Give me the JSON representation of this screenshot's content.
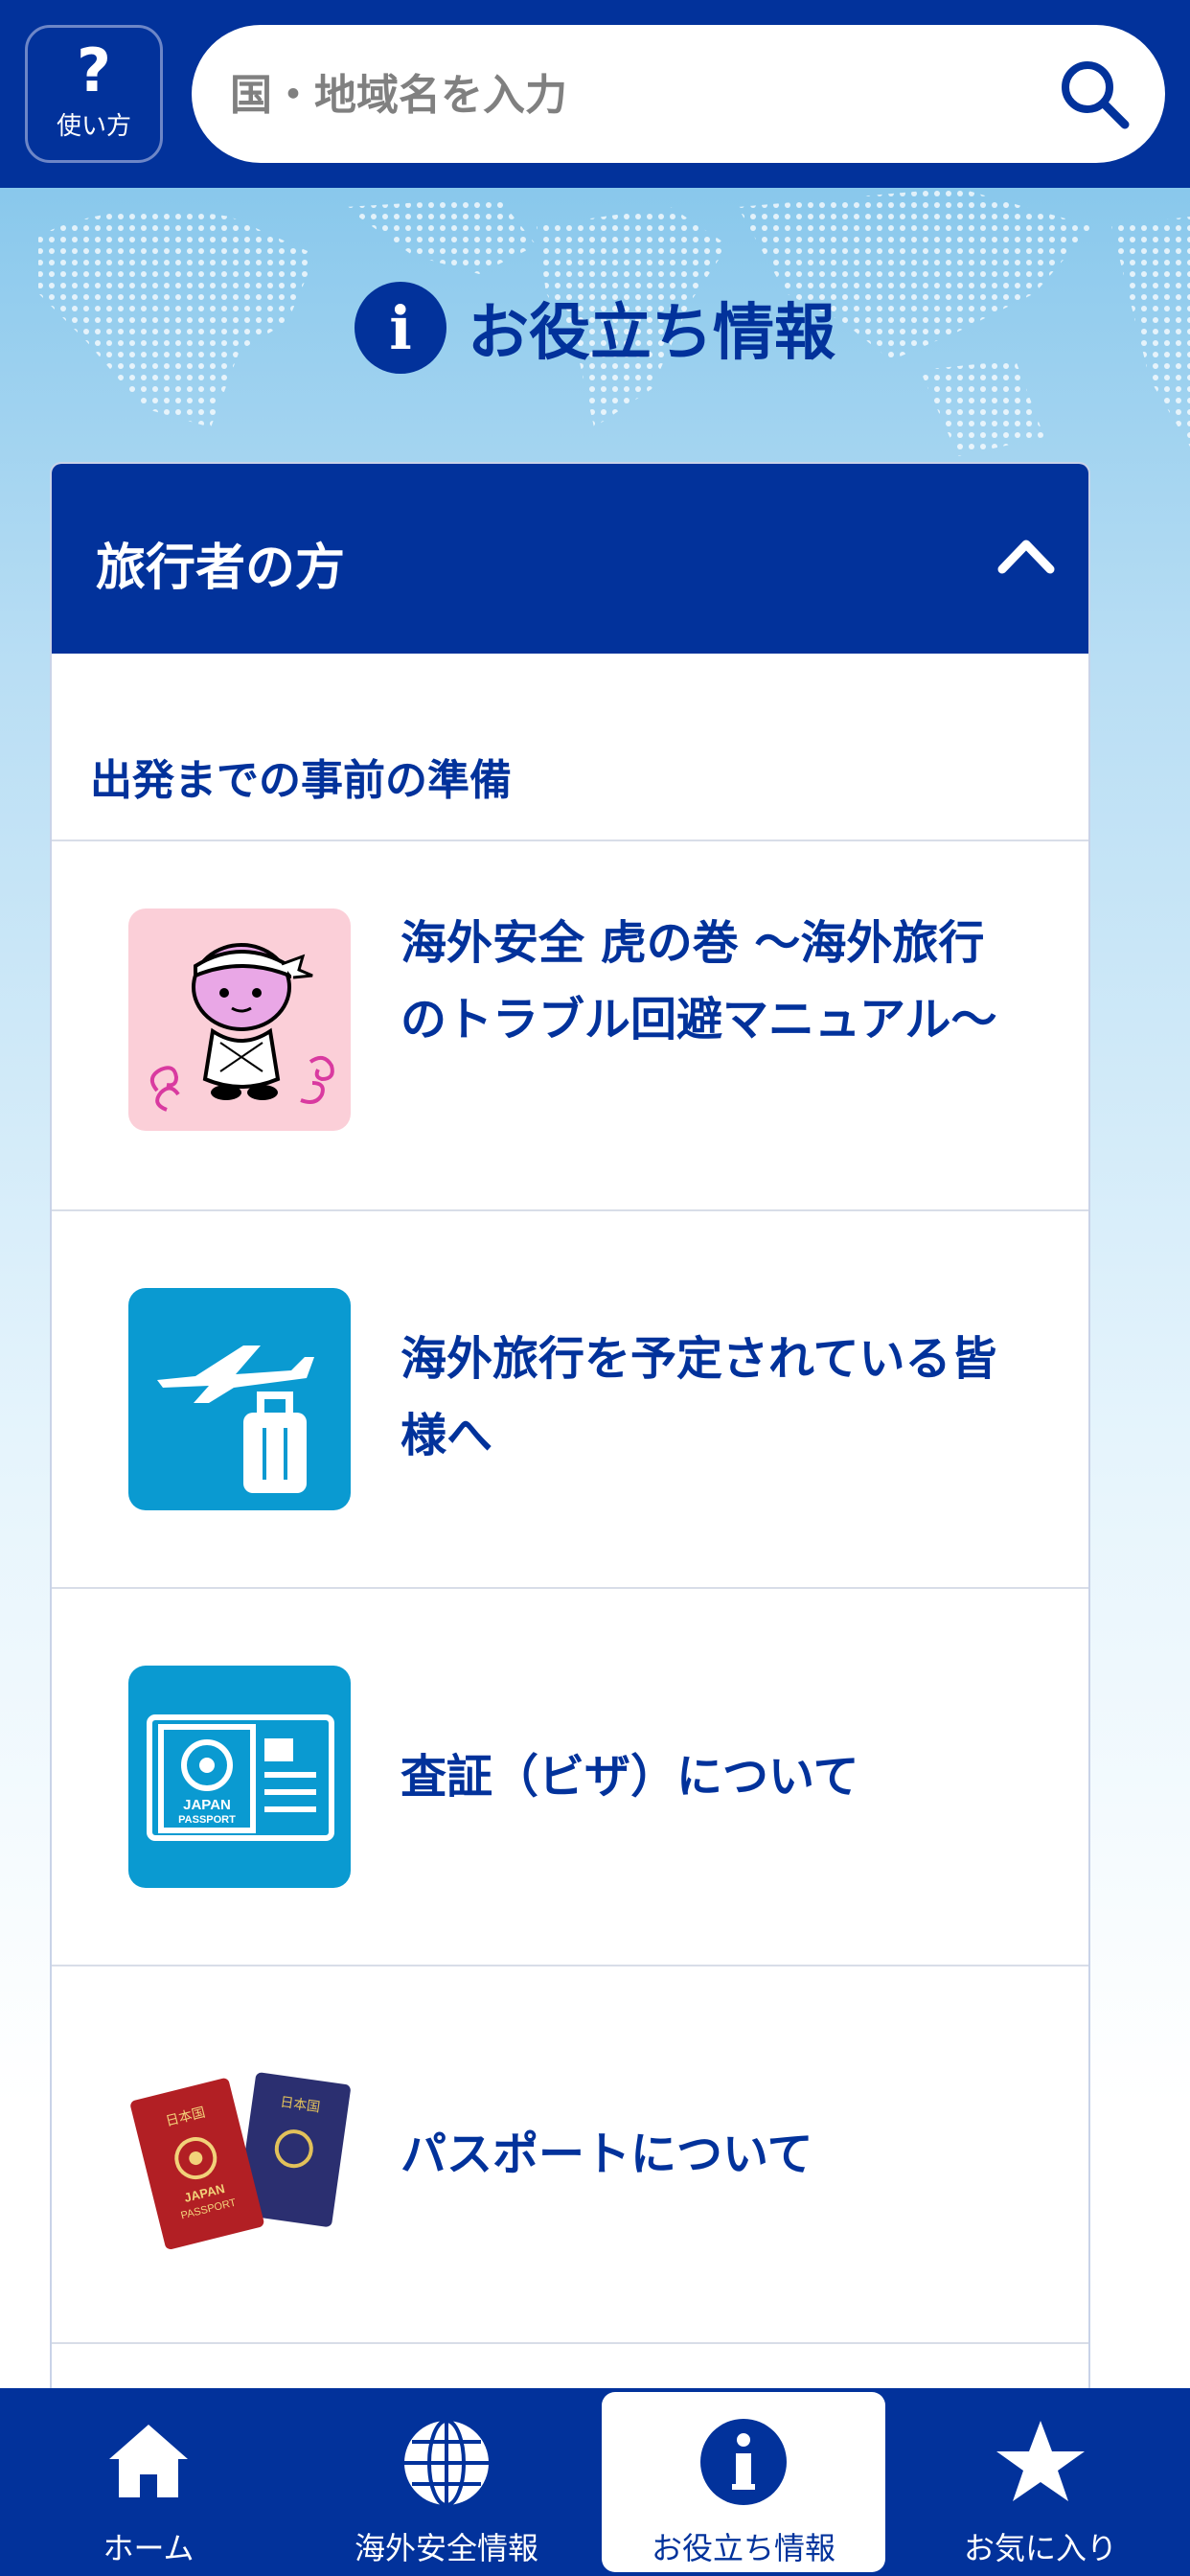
{
  "header": {
    "help_label": "使い方",
    "help_symbol": "?",
    "search_placeholder": "国・地域名を入力"
  },
  "page": {
    "title": "お役立ち情報",
    "info_symbol": "i"
  },
  "card": {
    "title": "旅行者の方",
    "section_title": "出発までの事前の準備",
    "items": [
      {
        "label": "海外安全 虎の巻 ～海外旅行のトラブル回避マニュアル～",
        "icon": "tiger-mascot-icon"
      },
      {
        "label": "海外旅行を予定されている皆様へ",
        "icon": "airplane-suitcase-icon"
      },
      {
        "label": "査証（ビザ）について",
        "icon": "passport-visa-icon"
      },
      {
        "label": "パスポートについて",
        "icon": "passports-icon"
      }
    ],
    "passport_texts": {
      "japan": "JAPAN",
      "passport": "PASSPORT",
      "nihonkoku": "日本国"
    }
  },
  "bottom_nav": {
    "items": [
      {
        "label": "ホーム",
        "icon": "home-icon"
      },
      {
        "label": "海外安全情報",
        "icon": "globe-icon"
      },
      {
        "label": "お役立ち情報",
        "icon": "info-icon",
        "active": true
      },
      {
        "label": "お気に入り",
        "icon": "star-icon"
      }
    ]
  },
  "colors": {
    "brand": "#02329b",
    "accent_blue": "#0a9ad1",
    "tiger_bg": "#fbcfd8"
  }
}
